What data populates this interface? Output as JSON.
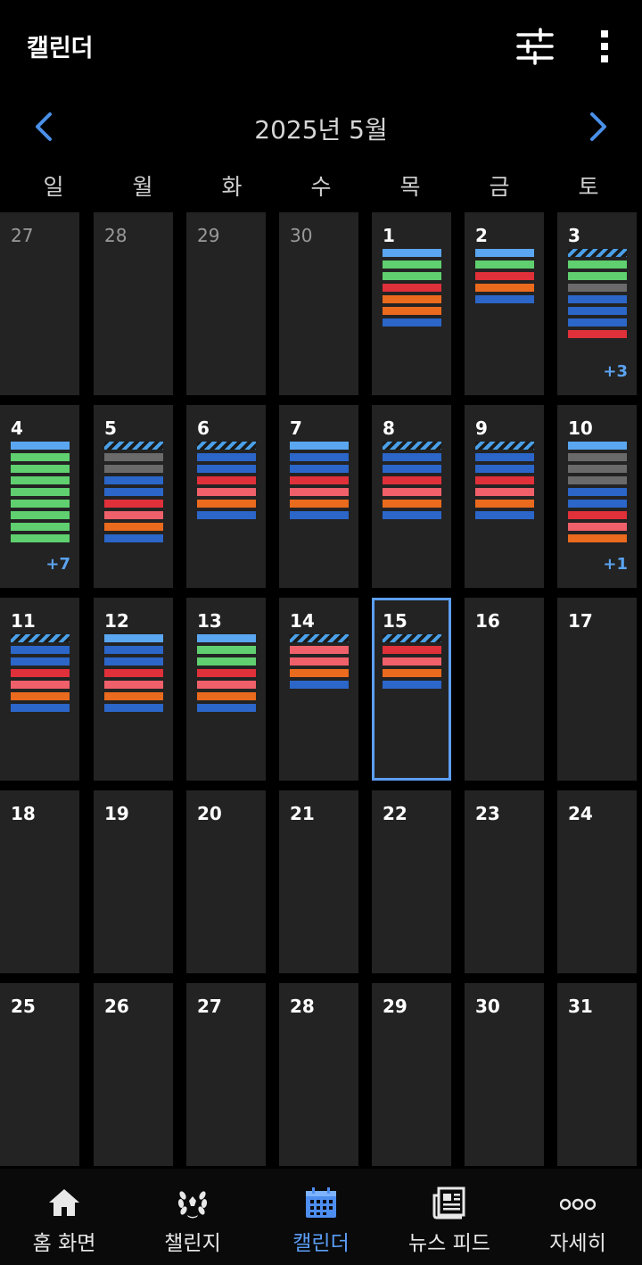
{
  "header": {
    "title": "캘린더"
  },
  "month": {
    "label": "2025년 5월"
  },
  "weekdays": [
    "일",
    "월",
    "화",
    "수",
    "목",
    "금",
    "토"
  ],
  "colors": {
    "light_blue": "#5aa6f0",
    "blue": "#2b66c8",
    "green": "#5fcf6f",
    "red": "#e0303a",
    "salmon": "#f0606a",
    "orange": "#ea6a1e",
    "gray": "#6a6a6a",
    "striped": "stripe",
    "accent": "#5c9ef5",
    "cell_bg": "#232323"
  },
  "weeks": [
    [
      {
        "day": "27",
        "other": true,
        "bars": []
      },
      {
        "day": "28",
        "other": true,
        "bars": []
      },
      {
        "day": "29",
        "other": true,
        "bars": []
      },
      {
        "day": "30",
        "other": true,
        "bars": []
      },
      {
        "day": "1",
        "bars": [
          "light_blue",
          "green",
          "green",
          "red",
          "orange",
          "orange",
          "blue"
        ]
      },
      {
        "day": "2",
        "bars": [
          "light_blue",
          "green",
          "red",
          "orange",
          "blue"
        ]
      },
      {
        "day": "3",
        "bars": [
          "striped",
          "green",
          "green",
          "gray",
          "blue",
          "blue",
          "blue",
          "red"
        ],
        "more": "+3"
      }
    ],
    [
      {
        "day": "4",
        "bars": [
          "light_blue",
          "green",
          "green",
          "green",
          "green",
          "green",
          "green",
          "green",
          "green"
        ],
        "more": "+7"
      },
      {
        "day": "5",
        "bars": [
          "striped",
          "gray",
          "gray",
          "blue",
          "blue",
          "red",
          "salmon",
          "orange",
          "blue"
        ]
      },
      {
        "day": "6",
        "bars": [
          "striped",
          "blue",
          "blue",
          "red",
          "salmon",
          "orange",
          "blue"
        ]
      },
      {
        "day": "7",
        "bars": [
          "light_blue",
          "blue",
          "blue",
          "red",
          "salmon",
          "orange",
          "blue"
        ]
      },
      {
        "day": "8",
        "bars": [
          "striped",
          "blue",
          "blue",
          "red",
          "salmon",
          "orange",
          "blue"
        ]
      },
      {
        "day": "9",
        "bars": [
          "striped",
          "blue",
          "blue",
          "red",
          "salmon",
          "orange",
          "blue"
        ]
      },
      {
        "day": "10",
        "bars": [
          "light_blue",
          "gray",
          "gray",
          "gray",
          "blue",
          "blue",
          "red",
          "salmon",
          "orange"
        ],
        "more": "+1"
      }
    ],
    [
      {
        "day": "11",
        "bars": [
          "striped",
          "blue",
          "blue",
          "red",
          "salmon",
          "orange",
          "blue"
        ]
      },
      {
        "day": "12",
        "bars": [
          "light_blue",
          "blue",
          "blue",
          "red",
          "salmon",
          "orange",
          "blue"
        ]
      },
      {
        "day": "13",
        "bars": [
          "light_blue",
          "green",
          "green",
          "red",
          "salmon",
          "orange",
          "blue"
        ]
      },
      {
        "day": "14",
        "bars": [
          "striped",
          "salmon",
          "salmon",
          "orange",
          "blue"
        ]
      },
      {
        "day": "15",
        "selected": true,
        "bars": [
          "striped",
          "red",
          "salmon",
          "orange",
          "blue"
        ]
      },
      {
        "day": "16",
        "bars": []
      },
      {
        "day": "17",
        "bars": []
      }
    ],
    [
      {
        "day": "18",
        "bars": []
      },
      {
        "day": "19",
        "bars": []
      },
      {
        "day": "20",
        "bars": []
      },
      {
        "day": "21",
        "bars": []
      },
      {
        "day": "22",
        "bars": []
      },
      {
        "day": "23",
        "bars": []
      },
      {
        "day": "24",
        "bars": []
      }
    ],
    [
      {
        "day": "25",
        "bars": []
      },
      {
        "day": "26",
        "bars": []
      },
      {
        "day": "27",
        "bars": []
      },
      {
        "day": "28",
        "bars": []
      },
      {
        "day": "29",
        "bars": []
      },
      {
        "day": "30",
        "bars": []
      },
      {
        "day": "31",
        "bars": []
      }
    ]
  ],
  "bottom_nav": [
    {
      "label": "홈 화면",
      "icon": "home-icon"
    },
    {
      "label": "챌린지",
      "icon": "laurel-icon"
    },
    {
      "label": "캘린더",
      "icon": "calendar-icon",
      "active": true
    },
    {
      "label": "뉴스 피드",
      "icon": "newspaper-icon"
    },
    {
      "label": "자세히",
      "icon": "more-circles-icon"
    }
  ]
}
